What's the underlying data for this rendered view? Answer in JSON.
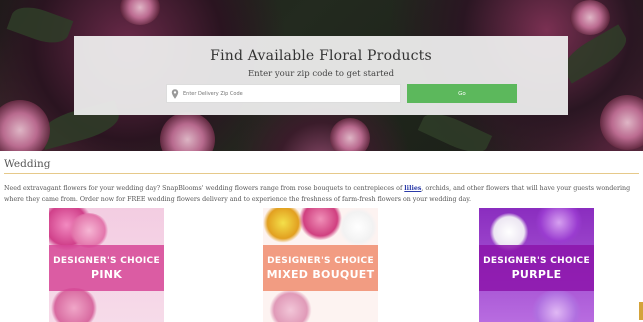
{
  "search": {
    "title": "Find Available Floral Products",
    "subtitle": "Enter your zip code to get started",
    "placeholder": "Enter Delivery Zip Code",
    "button_label": "Go"
  },
  "section": {
    "title": "Wedding",
    "desc_before": "Need extravagant flowers for your wedding day? SnapBlooms' wedding flowers range from rose bouquets to centrepieces of ",
    "desc_link": "lilies",
    "desc_after": ", orchids, and other flowers that will have your guests wondering where they came from. Order now for FREE wedding flowers delivery and to experience the freshness of farm-fresh flowers on your wedding day."
  },
  "products": [
    {
      "line1": "DESIGNER'S CHOICE",
      "line2": "PINK"
    },
    {
      "line1": "DESIGNER'S CHOICE",
      "line2": "MIXED BOUQUET"
    },
    {
      "line1": "DESIGNER'S CHOICE",
      "line2": "PURPLE"
    }
  ],
  "colors": {
    "go_button": "#5cb85c",
    "rule": "#e6c98a",
    "link": "#2a3aa8"
  }
}
